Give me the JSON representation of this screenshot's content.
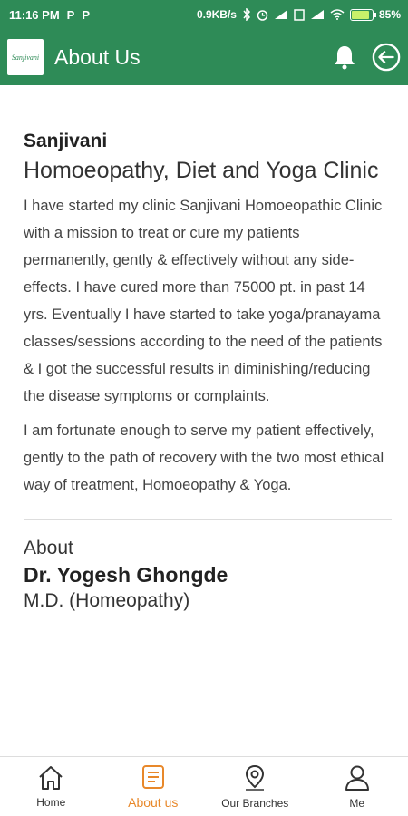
{
  "status_bar": {
    "time": "11:16 PM",
    "left_icons": [
      "P",
      "P"
    ],
    "speed": "0.9KB/s",
    "battery_percent": "85%"
  },
  "app_bar": {
    "logo_text": "Sanjivani",
    "title": "About Us",
    "icons": [
      "bell-icon",
      "logout-icon"
    ]
  },
  "content": {
    "clinic_name": "Sanjivani",
    "clinic_subtitle": "Homoeopathy, Diet and Yoga Clinic",
    "paragraph_1": "I have started my clinic Sanjivani Homoeopathic Clinic with a mission to treat or cure my patients permanently, gently & effectively without any side-effects. I have cured more than 75000 pt. in past 14 yrs. Eventually I have started to take yoga/pranayama classes/sessions according to the need of the patients & I got the successful results in diminishing/reducing the disease symptoms or complaints.",
    "paragraph_2": "I am fortunate enough to serve my patient effectively, gently to the path of recovery with the two most ethical way of treatment, Homoeopathy & Yoga.",
    "about_label": "About",
    "doctor_name": "Dr. Yogesh Ghongde",
    "doctor_degree": "M.D. (Homeopathy)"
  },
  "bottom_nav": {
    "items": [
      {
        "label": "Home",
        "icon": "home-icon"
      },
      {
        "label": "About us",
        "icon": "document-icon",
        "active": true
      },
      {
        "label": "Our Branches",
        "icon": "location-pin-icon"
      },
      {
        "label": "Me",
        "icon": "person-icon"
      }
    ]
  },
  "colors": {
    "primary": "#2e8b57",
    "active": "#e8882a"
  }
}
